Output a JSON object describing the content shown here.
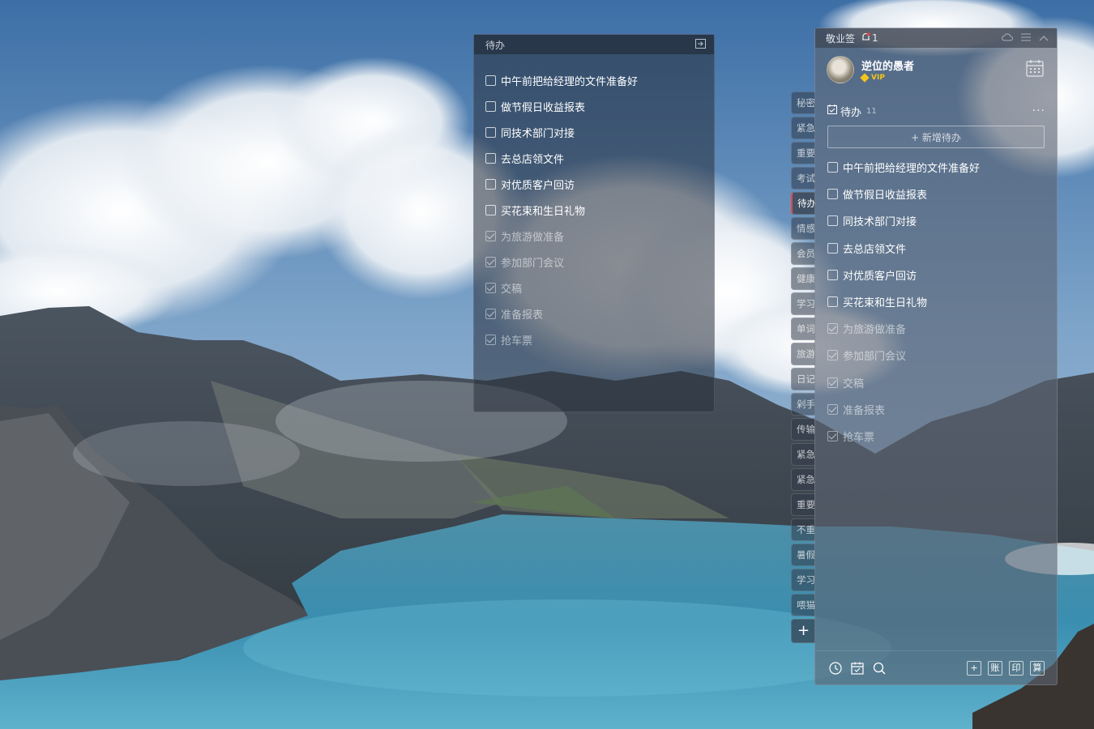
{
  "note_window": {
    "title": "待办",
    "items": [
      {
        "text": "中午前把给经理的文件准备好",
        "done": false
      },
      {
        "text": "做节假日收益报表",
        "done": false
      },
      {
        "text": "同技术部门对接",
        "done": false
      },
      {
        "text": "去总店领文件",
        "done": false
      },
      {
        "text": "对优质客户回访",
        "done": false
      },
      {
        "text": "买花束和生日礼物",
        "done": false
      },
      {
        "text": "为旅游做准备",
        "done": true
      },
      {
        "text": "参加部门会议",
        "done": true
      },
      {
        "text": "交稿",
        "done": true
      },
      {
        "text": "准备报表",
        "done": true
      },
      {
        "text": "抢车票",
        "done": true
      }
    ]
  },
  "tabs": [
    {
      "label": "秘密",
      "active": false
    },
    {
      "label": "紧急",
      "active": false
    },
    {
      "label": "重要",
      "active": false
    },
    {
      "label": "考试",
      "active": false
    },
    {
      "label": "待办",
      "active": true
    },
    {
      "label": "情感",
      "active": false
    },
    {
      "label": "会员",
      "active": false
    },
    {
      "label": "健康",
      "active": false
    },
    {
      "label": "学习",
      "active": false
    },
    {
      "label": "单词",
      "active": false
    },
    {
      "label": "旅游",
      "active": false
    },
    {
      "label": "日记",
      "active": false
    },
    {
      "label": "剁手",
      "active": false
    },
    {
      "label": "传输",
      "active": false
    },
    {
      "label": "紧急",
      "active": false
    },
    {
      "label": "紧急",
      "active": false
    },
    {
      "label": "重要",
      "active": false
    },
    {
      "label": "不重",
      "active": false
    },
    {
      "label": "暑假",
      "active": false
    },
    {
      "label": "学习",
      "active": false
    },
    {
      "label": "喂猫",
      "active": false
    }
  ],
  "tab_add_label": "+",
  "panel": {
    "app_title": "敬业签",
    "notification_count": "1",
    "user": {
      "name": "逆位的愚者",
      "badge": "VIP"
    },
    "section": {
      "title": "待办",
      "count": "11",
      "more": "···"
    },
    "add_button": "+ 新增待办",
    "todos": [
      {
        "text": "中午前把给经理的文件准备好",
        "done": false
      },
      {
        "text": "做节假日收益报表",
        "done": false
      },
      {
        "text": "同技术部门对接",
        "done": false
      },
      {
        "text": "去总店领文件",
        "done": false
      },
      {
        "text": "对优质客户回访",
        "done": false
      },
      {
        "text": "买花束和生日礼物",
        "done": false
      },
      {
        "text": "为旅游做准备",
        "done": true
      },
      {
        "text": "参加部门会议",
        "done": true
      },
      {
        "text": "交稿",
        "done": true
      },
      {
        "text": "准备报表",
        "done": true
      },
      {
        "text": "抢车票",
        "done": true
      }
    ],
    "footer": {
      "add": "+",
      "ledger": "账",
      "print": "印",
      "calc": "算"
    }
  }
}
